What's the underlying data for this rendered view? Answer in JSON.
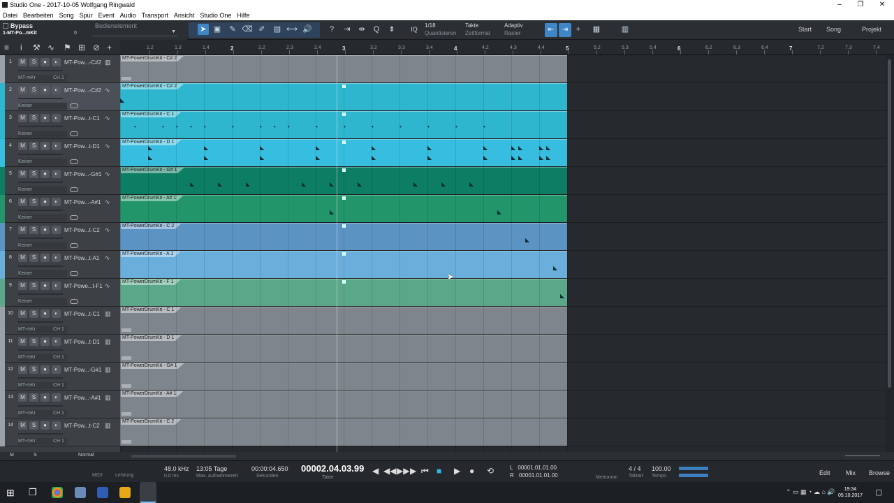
{
  "window": {
    "title": "Studio One - 2017-10-05 Wolfgang Ringwald"
  },
  "menu": [
    "Datei",
    "Bearbeiten",
    "Song",
    "Spur",
    "Event",
    "Audio",
    "Transport",
    "Ansicht",
    "Studio One",
    "Hilfe"
  ],
  "inspector": {
    "bypass": "Bypass",
    "instrument": "1-MT-Po...mKit",
    "value": "0",
    "element": "Bedienelement"
  },
  "quantize": {
    "value": "1/18",
    "label": "Quantisieren"
  },
  "timeformat": {
    "value": "Takte",
    "label": "Zeitformat"
  },
  "grid": {
    "value": "Adaptiv",
    "label": "Raster"
  },
  "nav": {
    "start": "Start",
    "song": "Song",
    "project": "Projekt"
  },
  "ruler": [
    "1.2",
    "1.3",
    "1.4",
    "2",
    "2.2",
    "2.3",
    "2.4",
    "3",
    "3.2",
    "3.3",
    "3.4",
    "4",
    "4.2",
    "4.3",
    "4.4",
    "5",
    "5.2",
    "5.3",
    "5.4",
    "6",
    "6.2",
    "6.3",
    "6.4",
    "7",
    "7.2",
    "7.3",
    "7.4"
  ],
  "tracks": [
    {
      "num": "1",
      "name": "MT-Pow...-C#2",
      "sub": "MT-mKr",
      "ch": "CH 1",
      "type": "instrument",
      "clip": "MT-PowerDrumKit - C# 2",
      "color": "#9aa1a8"
    },
    {
      "num": "2",
      "name": "MT-Pow...-C#2",
      "sub": "Keiner",
      "ch": "",
      "type": "audio",
      "clip": "MT-PowerDrumKit - C# 2",
      "color": "#2fb6cf"
    },
    {
      "num": "3",
      "name": "MT-Pow...t-C1",
      "sub": "Keiner",
      "ch": "",
      "type": "audio",
      "clip": "MT-PowerDrumKit - C 1",
      "color": "#2fb6cf"
    },
    {
      "num": "4",
      "name": "MT-Pow...t-D1",
      "sub": "Keiner",
      "ch": "",
      "type": "audio",
      "clip": "MT-PowerDrumKit - D 1",
      "color": "#37bde0"
    },
    {
      "num": "5",
      "name": "MT-Pow...-G#1",
      "sub": "Keiner",
      "ch": "",
      "type": "audio",
      "clip": "MT-PowerDrumKit - G# 1",
      "color": "#0d7d63"
    },
    {
      "num": "6",
      "name": "MT-Pow...-A#1",
      "sub": "Keiner",
      "ch": "",
      "type": "audio",
      "clip": "MT-PowerDrumKit - A# 1",
      "color": "#23956a"
    },
    {
      "num": "7",
      "name": "MT-Pow...t-C2",
      "sub": "Keiner",
      "ch": "",
      "type": "audio",
      "clip": "MT-PowerDrumKit - C 2",
      "color": "#5b93c3"
    },
    {
      "num": "8",
      "name": "MT-Pow...t-A1",
      "sub": "Keiner",
      "ch": "",
      "type": "audio",
      "clip": "MT-PowerDrumKit - A 1",
      "color": "#6aaedc"
    },
    {
      "num": "9",
      "name": "MT-Powe...t-F1",
      "sub": "Keiner",
      "ch": "",
      "type": "audio",
      "clip": "MT-PowerDrumKit - F 1",
      "color": "#5aa889"
    },
    {
      "num": "10",
      "name": "MT-Pow...t-C1",
      "sub": "MT-mKr",
      "ch": "CH 1",
      "type": "instrument",
      "clip": "MT-PowerDrumKit - C 1",
      "color": "#9aa1a8"
    },
    {
      "num": "11",
      "name": "MT-Pow...t-D1",
      "sub": "MT-mKr",
      "ch": "CH 1",
      "type": "instrument",
      "clip": "MT-PowerDrumKit - D 1",
      "color": "#9aa1a8"
    },
    {
      "num": "12",
      "name": "MT-Pow...-G#1",
      "sub": "MT-mKr",
      "ch": "CH 1",
      "type": "instrument",
      "clip": "MT-PowerDrumKit - G# 1",
      "color": "#9aa1a8"
    },
    {
      "num": "13",
      "name": "MT-Pow...-A#1",
      "sub": "MT-mKr",
      "ch": "CH 1",
      "type": "instrument",
      "clip": "MT-PowerDrumKit - A# 1",
      "color": "#9aa1a8"
    },
    {
      "num": "14",
      "name": "MT-Pow...t-C2",
      "sub": "MT-mKr",
      "ch": "CH 1",
      "type": "instrument",
      "clip": "MT-PowerDrumKit - C 2",
      "color": "#9aa1a8"
    }
  ],
  "footer": {
    "m": "M",
    "s": "S",
    "mode": "Normal"
  },
  "transport": {
    "midi": "MIDI",
    "perf": "Leistung",
    "rate": "48.0 kHz",
    "latency": "0.0 ms",
    "maxrec": "13:05 Tage",
    "maxrec_label": "Max. Aufnahmezeit",
    "seconds": "00:00:04.650",
    "seconds_label": "Sekunden",
    "bars": "00002.04.03.99",
    "bars_label": "Takte",
    "left": "00001.01.01.00",
    "right": "00001.01.01.00",
    "L": "L",
    "R": "R",
    "metronome": "Metronom",
    "timesig": "4 / 4",
    "timesig_label": "Taktart",
    "tempo": "100.00",
    "tempo_label": "Tempo",
    "edit": "Edit",
    "mix": "Mix",
    "browse": "Browse"
  },
  "clock": {
    "time": "19:34",
    "date": "05.10.2017"
  }
}
